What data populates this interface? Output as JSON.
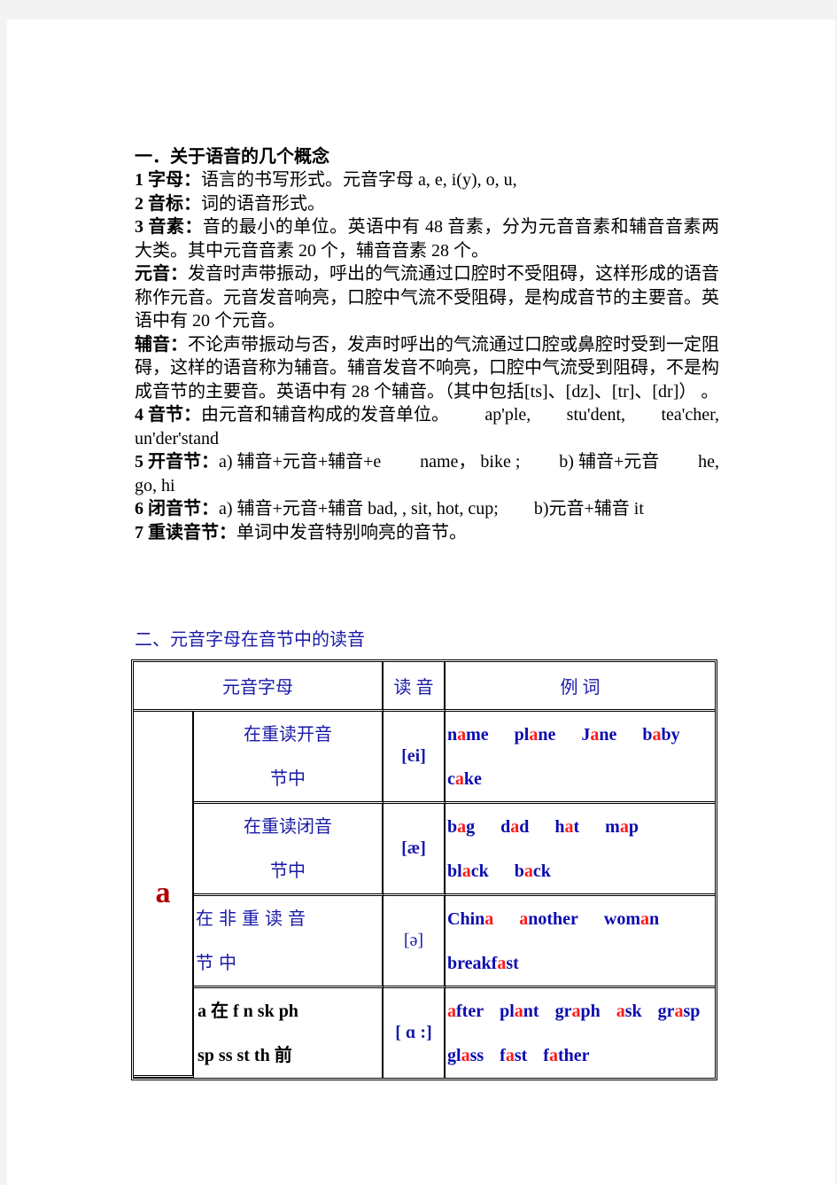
{
  "section1": {
    "title": "一．关于语音的几个概念",
    "items": [
      {
        "label": "1 字母：",
        "text": "语言的书写形式。元音字母 a, e, i(y), o, u,"
      },
      {
        "label": "2 音标：",
        "text": "词的语音形式。"
      },
      {
        "label": "3 音素：",
        "text": "音的最小的单位。英语中有 48 音素，分为元音音素和辅音音素两大类。其中元音音素 20 个，辅音音素 28 个。"
      },
      {
        "label": "元音：",
        "text": "发音时声带振动，呼出的气流通过口腔时不受阻碍，这样形成的语音称作元音。元音发音响亮，口腔中气流不受阻碍，是构成音节的主要音。英语中有 20 个元音。"
      },
      {
        "label": "辅音：",
        "text": "不论声带振动与否，发声时呼出的气流通过口腔或鼻腔时受到一定阻碍，这样的语音称为辅音。辅音发音不响亮，口腔中气流受到阻碍，不是构成音节的主要音。英语中有 28 个辅音。（其中包括[ts]、[dz]、[tr]、[dr]） 。"
      }
    ],
    "item4": {
      "label": "4 音节：",
      "text": "由元音和辅音构成的发音单位。",
      "examples": [
        "ap'ple,",
        "stu'dent,",
        "tea'cher,"
      ],
      "cont": "un'der'stand"
    },
    "item5": {
      "label": "5 开音节：",
      "a": "a)  辅音+元音+辅音+e",
      "a_ex": "name，  bike ;",
      "b": "b)  辅音+元音",
      "b_ex": "he,",
      "cont": "go, hi"
    },
    "item6": {
      "label": "6 闭音节：",
      "a": "a)  辅音+元音+辅音  bad, , sit, hot, cup;",
      "b": "b)元音+辅音 it"
    },
    "item7": {
      "label": "7 重读音节：",
      "text": "单词中发音特别响亮的音节。"
    }
  },
  "section2": {
    "title": "二、元音字母在音节中的读音",
    "table": {
      "headers": [
        "元音字母",
        "读  音",
        "例  词"
      ],
      "letter": "a",
      "rows": [
        {
          "position": [
            "在重读开音",
            "节中"
          ],
          "ipa": "[ei]",
          "examples": [
            [
              {
                "t": "n"
              },
              {
                "t": "a",
                "hl": true
              },
              {
                "t": "me"
              }
            ],
            [
              {
                "t": "pl"
              },
              {
                "t": "a",
                "hl": true
              },
              {
                "t": "ne"
              }
            ],
            [
              {
                "t": "J"
              },
              {
                "t": "a",
                "hl": true
              },
              {
                "t": "ne"
              }
            ],
            [
              {
                "t": "b"
              },
              {
                "t": "a",
                "hl": true
              },
              {
                "t": "by"
              }
            ],
            [
              {
                "t": "c"
              },
              {
                "t": "a",
                "hl": true
              },
              {
                "t": "ke"
              }
            ]
          ]
        },
        {
          "position": [
            "在重读闭音",
            "节中"
          ],
          "ipa": "[æ]",
          "examples": [
            [
              {
                "t": "b"
              },
              {
                "t": "a",
                "hl": true
              },
              {
                "t": "g"
              }
            ],
            [
              {
                "t": "d"
              },
              {
                "t": "a",
                "hl": true
              },
              {
                "t": "d"
              }
            ],
            [
              {
                "t": "h"
              },
              {
                "t": "a",
                "hl": true
              },
              {
                "t": "t"
              }
            ],
            [
              {
                "t": "m"
              },
              {
                "t": "a",
                "hl": true
              },
              {
                "t": "p"
              }
            ],
            [
              {
                "t": "bl"
              },
              {
                "t": "a",
                "hl": true
              },
              {
                "t": "ck"
              }
            ],
            [
              {
                "t": "b"
              },
              {
                "t": "a",
                "hl": true
              },
              {
                "t": "ck"
              }
            ]
          ]
        },
        {
          "position": [
            "在非重读音",
            "节中"
          ],
          "ipa": "[ə]",
          "examples": [
            [
              {
                "t": "Chin"
              },
              {
                "t": "a",
                "hl": true
              }
            ],
            [
              {
                "t": "a",
                "hl": true
              },
              {
                "t": "nother"
              }
            ],
            [
              {
                "t": "wom"
              },
              {
                "t": "a",
                "hl": true
              },
              {
                "t": "n"
              }
            ],
            [
              {
                "t": "breakf"
              },
              {
                "t": "a",
                "hl": true
              },
              {
                "t": "st"
              }
            ]
          ]
        },
        {
          "position": [
            "a 在 f n sk ph",
            "sp ss st th 前"
          ],
          "ipa": "[ ɑ :]",
          "examples": [
            [
              {
                "t": "a",
                "hl": true
              },
              {
                "t": "fter"
              }
            ],
            [
              {
                "t": "pl"
              },
              {
                "t": "a",
                "hl": true
              },
              {
                "t": "nt"
              }
            ],
            [
              {
                "t": "gr"
              },
              {
                "t": "a",
                "hl": true
              },
              {
                "t": "ph"
              }
            ],
            [
              {
                "t": "a",
                "hl": true
              },
              {
                "t": "sk"
              }
            ],
            [
              {
                "t": "gr"
              },
              {
                "t": "a",
                "hl": true
              },
              {
                "t": "sp"
              }
            ],
            [
              {
                "t": "gl"
              },
              {
                "t": "a",
                "hl": true
              },
              {
                "t": "ss"
              }
            ],
            [
              {
                "t": "f"
              },
              {
                "t": "a",
                "hl": true
              },
              {
                "t": "st"
              }
            ],
            [
              {
                "t": "f"
              },
              {
                "t": "a",
                "hl": true
              },
              {
                "t": "ther"
              }
            ]
          ]
        }
      ]
    }
  },
  "colors": {
    "heading_blue": "#1a1aa8",
    "example_blue": "#0a0ab0",
    "highlight_red": "#ff1a1a",
    "letter_red": "#b00000"
  }
}
